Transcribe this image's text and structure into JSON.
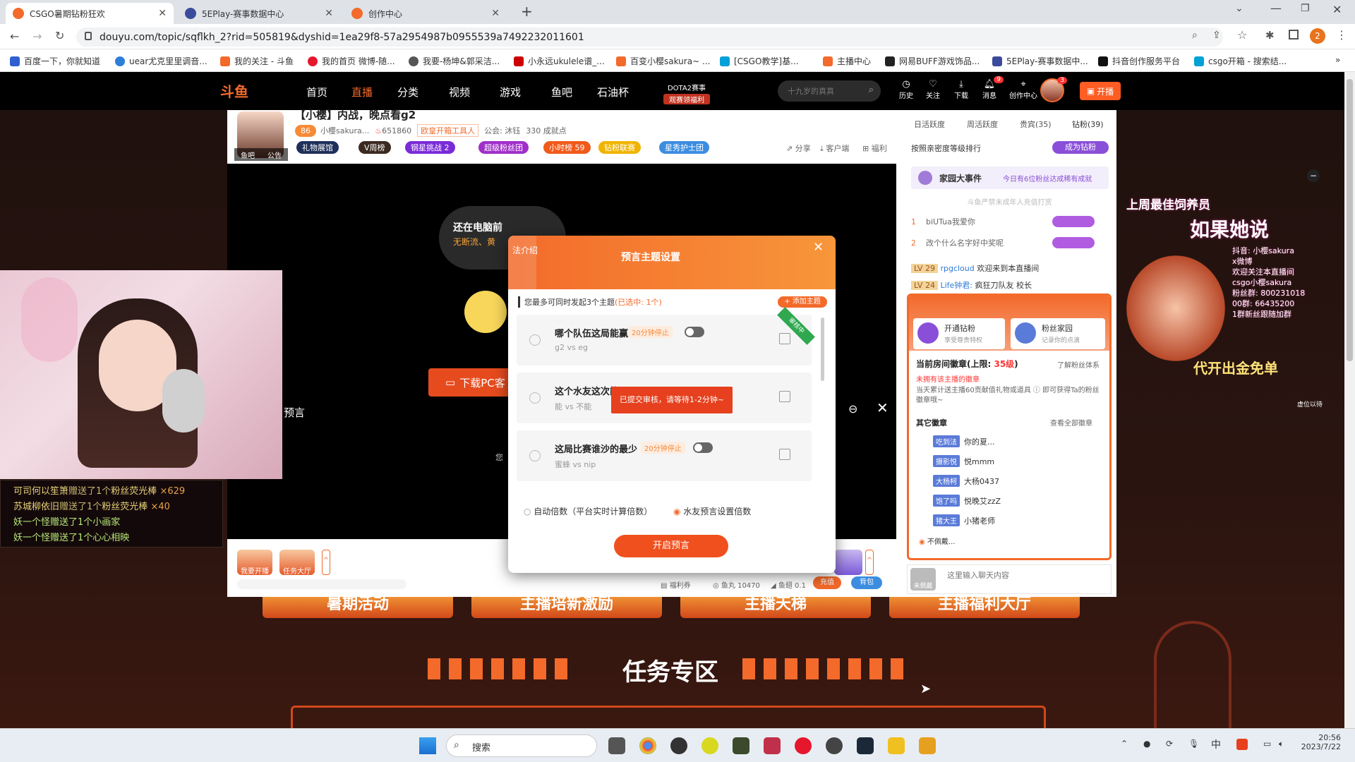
{
  "browser": {
    "tabs": [
      {
        "title": "CSGO暑期钻粉狂欢",
        "color": "#f36a2b"
      },
      {
        "title": "5EPlay-赛事数据中心",
        "color": "#3b4a9b"
      },
      {
        "title": "创作中心",
        "color": "#f36a2b"
      }
    ],
    "url": "douyu.com/topic/sqflkh_2?rid=505819&dyshid=1ea29f8-57a2954987b0955539a7492232011601",
    "bookmarks": [
      {
        "label": "百度一下，你就知道",
        "color": "#2f5fd0"
      },
      {
        "label": "uear尤克里里调音...",
        "color": "#2d7ed8"
      },
      {
        "label": "我的关注 - 斗鱼",
        "color": "#f36a2b"
      },
      {
        "label": "我的首页 微博-随...",
        "color": "#e6162d"
      },
      {
        "label": "我要-杨坤&郭采洁...",
        "color": "#555"
      },
      {
        "label": "小永远ukulele谱_...",
        "color": "#c00"
      },
      {
        "label": "百变小樱sakura~ ...",
        "color": "#f36a2b"
      },
      {
        "label": "[CSGO教学]基...",
        "color": "#00a1d6"
      },
      {
        "label": "主播中心",
        "color": "#f36a2b"
      },
      {
        "label": "网易BUFF游戏饰品...",
        "color": "#222"
      },
      {
        "label": "5EPlay-赛事数据中...",
        "color": "#3b4a9b"
      },
      {
        "label": "抖音创作服务平台",
        "color": "#111"
      },
      {
        "label": "csgo开箱 - 搜索结...",
        "color": "#00a1d6"
      }
    ],
    "profile_initial": "2"
  },
  "topnav": {
    "logo": "斗鱼",
    "items": [
      "首页",
      "直播",
      "分类",
      "视频",
      "游戏",
      "鱼吧",
      "石油杯"
    ],
    "promo_line1": "DOTA2赛事",
    "promo_line2": "观赛领福利",
    "search_placeholder": "十九岁的真真",
    "icons": [
      {
        "label": "历史",
        "badge": ""
      },
      {
        "label": "关注",
        "badge": ""
      },
      {
        "label": "下载",
        "badge": ""
      },
      {
        "label": "消息",
        "badge": "9"
      },
      {
        "label": "创作中心",
        "badge": ""
      }
    ],
    "avatar_badge": "3",
    "live_button": "开播"
  },
  "room": {
    "title": "【小樱】内战，晚点看g2",
    "level": "86",
    "streamer": "小樱sakura...",
    "heat": "651860",
    "tool_tag": "欧皇开箱工具人",
    "guild": "公会: 沐钰",
    "fans_count": "330 成就点",
    "avatar_tabs": [
      "鱼吧",
      "公告"
    ],
    "chips": [
      {
        "label": "礼物展馆",
        "color": "#1f2f5a"
      },
      {
        "label": "V周榜",
        "color": "#3a2a20"
      },
      {
        "label": "钢星挑战 2",
        "color": "#7a2bd8"
      },
      {
        "label": "超级粉丝团",
        "color": "#a02fc9"
      },
      {
        "label": "小时榜 59",
        "color": "#f05a1a"
      },
      {
        "label": "钻粉联赛",
        "color": "#f0b400"
      },
      {
        "label": "星秀护士团",
        "color": "#3c8de0"
      }
    ],
    "actions": [
      "分享",
      "客户端",
      "福利"
    ]
  },
  "video": {
    "bubble_line1": "还在电脑前",
    "bubble_line2": "无断流、黄",
    "download_btn": "下载PC客",
    "side_text": "预言",
    "small_text": "您"
  },
  "modal": {
    "left_tab": "法介绍",
    "title": "预言主题设置",
    "note": "您最多可同时发起3个主题",
    "note_selected": "(已选中: 1个)",
    "add_button": "+ 添加主题",
    "questions": [
      {
        "title": "哪个队伍这局能赢",
        "timer": "20分钟停止",
        "sub": "g2 vs eg",
        "ribbon": "审核中"
      },
      {
        "title": "这个水友这次能",
        "timer": "",
        "sub": "能 vs 不能",
        "toast": "已提交审核，请等待1-2分钟~"
      },
      {
        "title": "这局比赛谁沙的最少",
        "timer": "20分钟停止",
        "sub": "蜜蜂 vs nip"
      }
    ],
    "mode_auto": "自动倍数（平台实时计算倍数）",
    "mode_user": "水友预言设置倍数",
    "start_button": "开启预言"
  },
  "chat": {
    "tabs": [
      "日活跃度",
      "周活跃度",
      "贵宾(35)",
      "钻粉(39)"
    ],
    "rank_title": "按照亲密度等级排行",
    "become_fan": "成为钻粉",
    "family_title": "家园大事件",
    "family_sub": "今日有6位粉丝达成稀有成就",
    "fan_notice": "斗鱼严禁未成年人充值打赏",
    "rank_list": [
      {
        "rank": "1",
        "name": "biUTua我爱你"
      },
      {
        "rank": "2",
        "name": "改个什么名字好中奖呢"
      }
    ],
    "messages": [
      {
        "level": "LV 29",
        "user": "rpgcloud",
        "text": "欢迎来到本直播间"
      },
      {
        "level": "LV 24",
        "user": "Life钟君:",
        "text": "疯狂刀队友 校长"
      }
    ],
    "open_fan": "开通钻粉",
    "open_fan_sub": "享受尊贵特权",
    "fan_home": "粉丝家园",
    "fan_home_sub": "记录你的点滴",
    "badge_title": "当前房间徽章(上限: ",
    "badge_limit": "35级",
    "badge_link": "了解粉丝体系",
    "no_badge": "未拥有该主播的徽章",
    "badge_desc": "当天累计送主播60贡献值礼物或道具 ⓘ 即可获得Ta的粉丝徽章哦~",
    "other_badges": "其它徽章",
    "view_all": "查看全部徽章",
    "other_badge_list": [
      {
        "badge": "吃到法",
        "name": "你的夏..."
      },
      {
        "badge": "摄影悦",
        "name": "悦mmm"
      },
      {
        "badge": "大杨柯",
        "name": "大杨0437"
      },
      {
        "badge": "饱了吗",
        "name": "悦晚艾zzZ"
      },
      {
        "badge": "猪大王",
        "name": "小猪老师"
      }
    ],
    "not_wear": "不佩戴...",
    "input_placeholder": "这里输入聊天内容",
    "no_fan": "未佩戴"
  },
  "giftbar": {
    "items": [
      "我要开播",
      "任务大厅"
    ],
    "welfare": "福利券",
    "fishball": "鱼丸 10470",
    "fishcoin": "鱼翅 0.1",
    "recharge": "充值",
    "backpack": "背包"
  },
  "webcam": {
    "label": "webcam"
  },
  "giftlog": [
    {
      "user": "可司何以笙箫",
      "text": "赠送了1个",
      "gift": "粉丝荧光棒",
      "count": "×629"
    },
    {
      "user": "苏城柳依旧",
      "text": "赠送了1个",
      "gift": "粉丝荧光棒",
      "count": "×40"
    },
    {
      "user": "妖一个怪",
      "text": "赠送了1个",
      "gift": "小画家",
      "count": ""
    },
    {
      "user": "妖一个怪",
      "text": "赠送了1个",
      "gift": "心心相映",
      "count": ""
    }
  ],
  "overlay": {
    "banner_title": "上周最佳饲养员",
    "ruguo": "如果她说",
    "info_lines": [
      "抖音: 小樱sakura",
      "x微博",
      "欢迎关注本直播间",
      "csgo小樱sakura",
      "粉丝群: 800231018",
      "00群: 66435200",
      "1群新丝跟随加群",
      "代开出金免单"
    ],
    "bottom_text": "代开出金免单",
    "mini_badge": "虚位以待"
  },
  "bottom": {
    "task_title": "任务专区",
    "tabs_labels": [
      "暑期活动",
      "主播培新激励",
      "主播天梯",
      "主播福利大厅"
    ]
  },
  "taskbar": {
    "search": "搜索",
    "time": "20:56",
    "date": "2023/7/22",
    "ime": "中"
  }
}
